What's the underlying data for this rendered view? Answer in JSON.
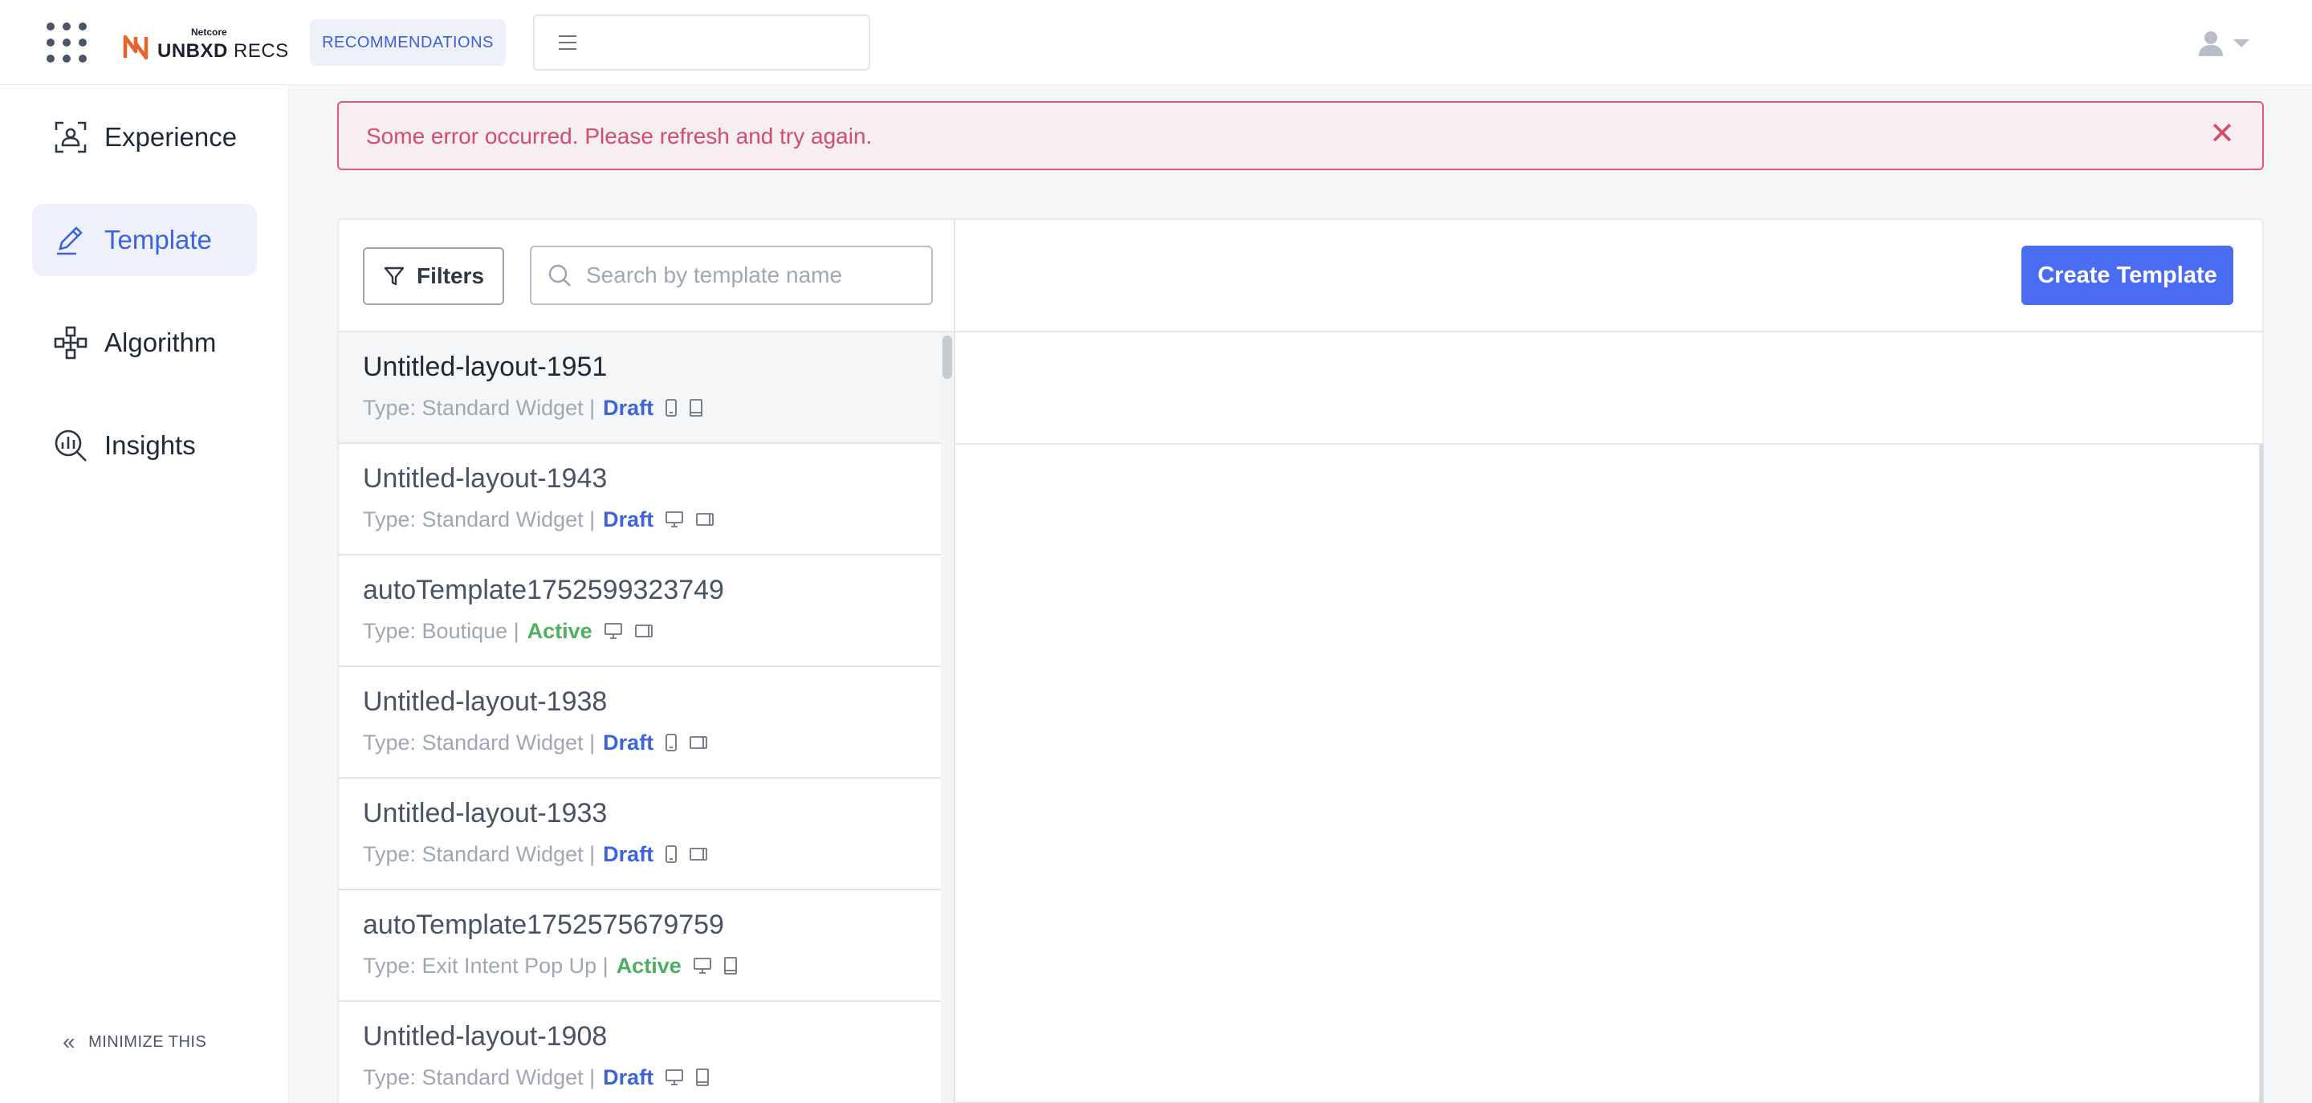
{
  "header": {
    "logo_small": "Netcore",
    "logo_bold": "UNBXD",
    "logo_rest": " RECS",
    "section_pill": "RECOMMENDATIONS"
  },
  "sidebar": {
    "items": [
      {
        "label": "Experience",
        "icon": "experience-icon",
        "active": false
      },
      {
        "label": "Template",
        "icon": "pencil-icon",
        "active": true
      },
      {
        "label": "Algorithm",
        "icon": "algorithm-icon",
        "active": false
      },
      {
        "label": "Insights",
        "icon": "insights-icon",
        "active": false
      }
    ],
    "minimize_label": "MINIMIZE THIS"
  },
  "alert": {
    "message": "Some error occurred. Please refresh and try again.",
    "close_symbol": "✕"
  },
  "toolbar": {
    "filters_label": "Filters",
    "search_placeholder": "Search by template name",
    "search_value": ""
  },
  "templates": [
    {
      "name": "Untitled-layout-1951",
      "type": "Type: Standard Widget |",
      "status": "Draft",
      "devices": [
        "mobile-icon",
        "tablet-icon"
      ]
    },
    {
      "name": "Untitled-layout-1943",
      "type": "Type: Standard Widget |",
      "status": "Draft",
      "devices": [
        "desktop-icon",
        "tablet-landscape-icon"
      ]
    },
    {
      "name": "autoTemplate1752599323749",
      "type": "Type: Boutique |",
      "status": "Active",
      "devices": [
        "desktop-icon",
        "tablet-landscape-icon"
      ]
    },
    {
      "name": "Untitled-layout-1938",
      "type": "Type: Standard Widget |",
      "status": "Draft",
      "devices": [
        "mobile-icon",
        "tablet-landscape-icon"
      ]
    },
    {
      "name": "Untitled-layout-1933",
      "type": "Type: Standard Widget |",
      "status": "Draft",
      "devices": [
        "mobile-icon",
        "tablet-landscape-icon"
      ]
    },
    {
      "name": "autoTemplate1752575679759",
      "type": "Type: Exit Intent Pop Up |",
      "status": "Active",
      "devices": [
        "desktop-icon",
        "tablet-icon"
      ]
    },
    {
      "name": "Untitled-layout-1908",
      "type": "Type: Standard Widget |",
      "status": "Draft",
      "devices": [
        "desktop-icon",
        "tablet-icon"
      ]
    }
  ],
  "actions": {
    "create_label": "Create Template"
  },
  "colors": {
    "accent": "#4a6cf0",
    "draft": "#3d63dd",
    "active": "#4caf63",
    "error": "#d14d6e"
  }
}
